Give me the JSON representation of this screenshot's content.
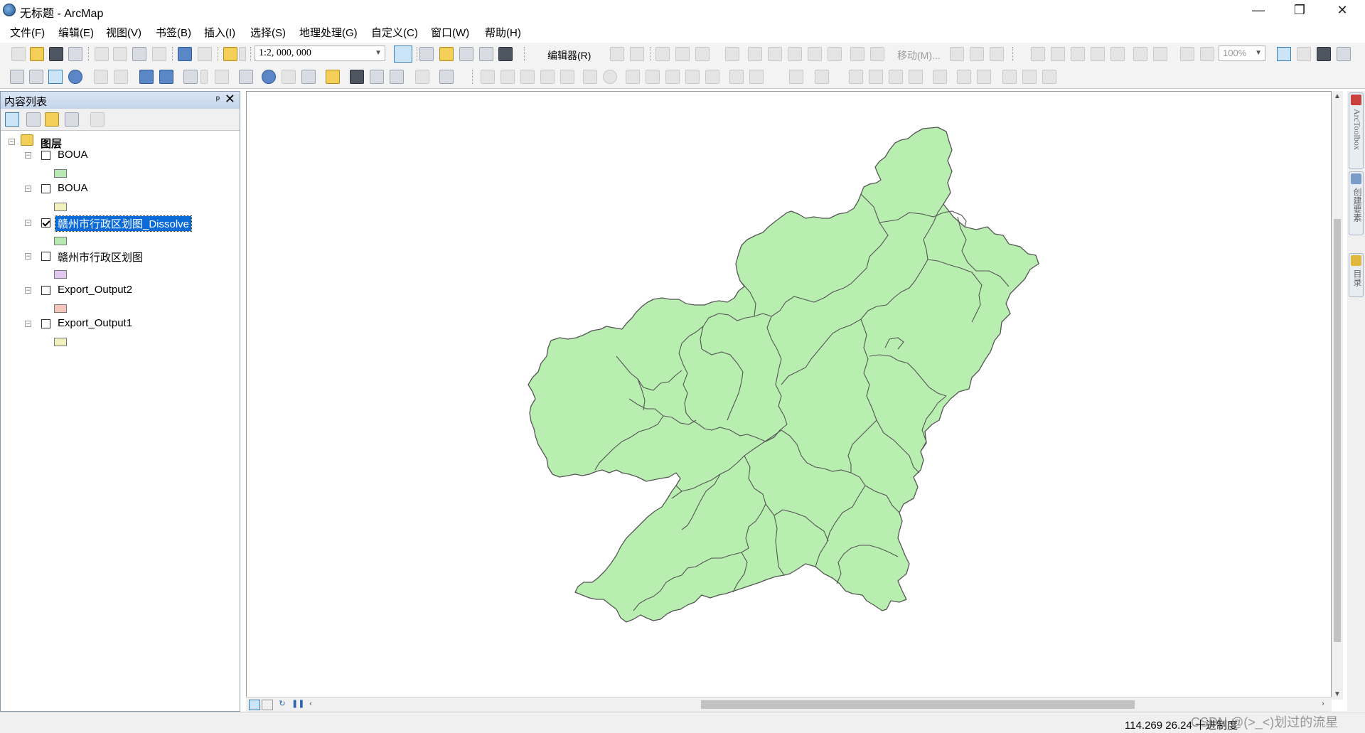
{
  "window": {
    "title": "无标题 - ArcMap",
    "controls": {
      "minimize": "—",
      "restore": "❐",
      "close": "✕"
    }
  },
  "menu": [
    "文件(F)",
    "编辑(E)",
    "视图(V)",
    "书签(B)",
    "插入(I)",
    "选择(S)",
    "地理处理(G)",
    "自定义(C)",
    "窗口(W)",
    "帮助(H)"
  ],
  "toolbar": {
    "scale": "1:2, 000, 000",
    "editor_label": "编辑器(R)",
    "move_label": "移动(M)...",
    "zoom_percent": "100%"
  },
  "toc": {
    "title": "内容列表",
    "pin": "ᵖ",
    "close": "✕",
    "group_label": "图层",
    "layers": [
      {
        "name": "BOUA",
        "checked": false,
        "selected": false,
        "color": "#b8e8b4"
      },
      {
        "name": "BOUA",
        "checked": false,
        "selected": false,
        "color": "#f2efbf"
      },
      {
        "name": "赣州市行政区划图_Dissolve",
        "checked": true,
        "selected": true,
        "color": "#b8e8b4"
      },
      {
        "name": "赣州市行政区划图",
        "checked": false,
        "selected": false,
        "color": "#e2c7f2"
      },
      {
        "name": "Export_Output2",
        "checked": false,
        "selected": false,
        "color": "#f6c6bd"
      },
      {
        "name": "Export_Output1",
        "checked": false,
        "selected": false,
        "color": "#f2efbf"
      }
    ]
  },
  "map": {
    "fill_color": "#b8eeb0",
    "stroke_color": "#555555"
  },
  "right_dock": [
    "ArcToolbox",
    "创建要素",
    "目录"
  ],
  "status": {
    "coordinates": "114.269  26.24 十进制度",
    "watermark": "CSDN @(>_<)划过的流星"
  }
}
